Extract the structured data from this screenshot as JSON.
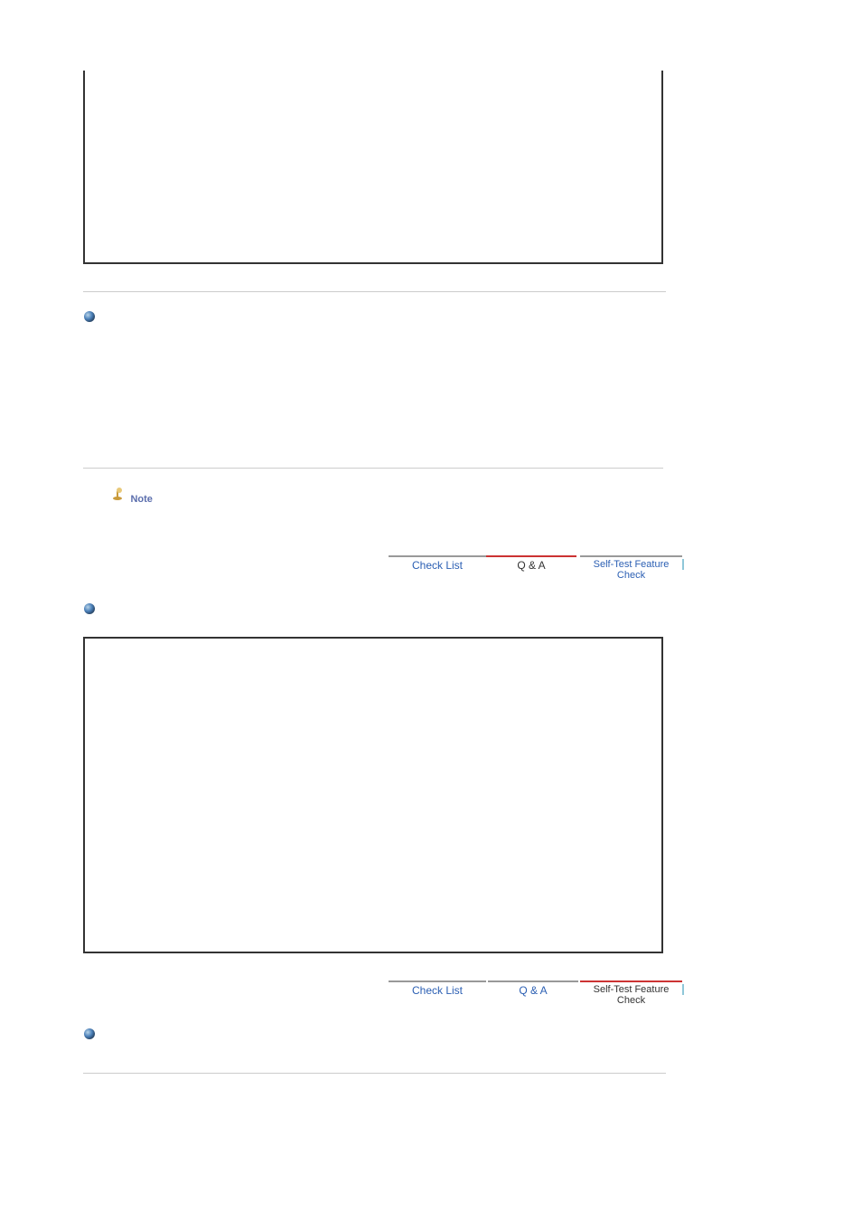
{
  "note": {
    "label": "Note"
  },
  "tabs": {
    "check_list": "Check List",
    "qa": "Q & A",
    "self_test": "Self-Test Feature Check"
  },
  "colors": {
    "link": "#2B5FB3",
    "text": "#333333",
    "note": "#5B6EAD",
    "accent_red": "#CC3333",
    "border_gray": "#999999",
    "pipe": "#8FC7D9"
  }
}
